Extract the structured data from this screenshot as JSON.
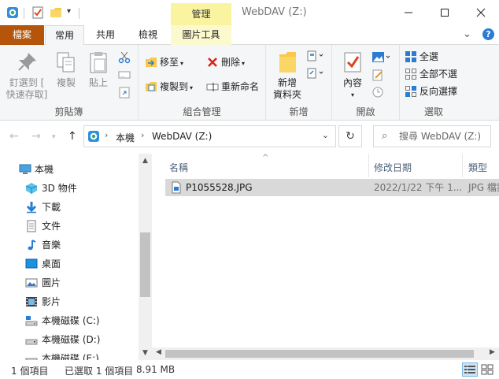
{
  "titlebar": {
    "context_tab_header": "管理",
    "title": "WebDAV (Z:)",
    "qat_icons": [
      "webdav-drive-icon",
      "properties-check-icon",
      "new-folder-icon",
      "qat-customize-icon"
    ],
    "window_buttons": [
      "minimize",
      "maximize",
      "close"
    ]
  },
  "tabs": [
    {
      "label": "檔案",
      "kind": "file"
    },
    {
      "label": "常用",
      "kind": "active"
    },
    {
      "label": "共用",
      "kind": "normal"
    },
    {
      "label": "檢視",
      "kind": "normal"
    },
    {
      "label": "圖片工具",
      "kind": "context"
    }
  ],
  "ribbon": {
    "clipboard": {
      "label": "剪貼簿",
      "pin_quick_access": {
        "line1": "釘選到 [",
        "line2": "快速存取]"
      },
      "copy": "複製",
      "paste": "貼上"
    },
    "organize": {
      "label": "組合管理",
      "move_to": "移至",
      "copy_to": "複製到",
      "delete": "刪除",
      "rename": "重新命名"
    },
    "new": {
      "label": "新增",
      "new_folder": {
        "line1": "新增",
        "line2": "資料夾"
      }
    },
    "open": {
      "label": "開啟",
      "properties": "內容"
    },
    "select": {
      "label": "選取",
      "select_all": "全選",
      "select_none": "全部不選",
      "invert_selection": "反向選擇"
    }
  },
  "address": {
    "crumbs": [
      "本機",
      "WebDAV (Z:)"
    ],
    "search_placeholder": "搜尋 WebDAV (Z:)"
  },
  "nav_pane": {
    "items": [
      {
        "label": "本機",
        "icon": "this-pc-icon"
      },
      {
        "label": "3D 物件",
        "icon": "3d-objects-icon"
      },
      {
        "label": "下載",
        "icon": "downloads-icon"
      },
      {
        "label": "文件",
        "icon": "documents-icon"
      },
      {
        "label": "音樂",
        "icon": "music-icon"
      },
      {
        "label": "桌面",
        "icon": "desktop-icon"
      },
      {
        "label": "圖片",
        "icon": "pictures-icon"
      },
      {
        "label": "影片",
        "icon": "videos-icon"
      },
      {
        "label": "本機磁碟 (C:)",
        "icon": "drive-c-icon"
      },
      {
        "label": "本機磁碟 (D:)",
        "icon": "drive-d-icon"
      },
      {
        "label": "本機磁碟 (E:)",
        "icon": "drive-e-icon"
      }
    ]
  },
  "file_list": {
    "columns": [
      "名稱",
      "修改日期",
      "類型"
    ],
    "rows": [
      {
        "name": "P1055528.JPG",
        "modified": "2022/1/22 下午 1...",
        "type": "JPG 檔案",
        "selected": true
      }
    ]
  },
  "status": {
    "item_count": "1 個項目",
    "selection": "已選取 1 個項目",
    "size": "8.91 MB"
  },
  "colors": {
    "file_tab": "#b4550b",
    "context_tab": "#faf4a0",
    "selected_row": "#d9d9d9",
    "accent_blue": "#2b7cd3"
  }
}
